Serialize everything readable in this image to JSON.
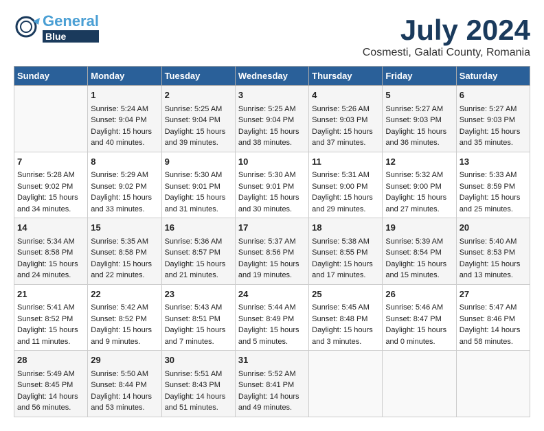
{
  "header": {
    "logo_general": "General",
    "logo_blue": "Blue",
    "month": "July 2024",
    "location": "Cosmesti, Galati County, Romania"
  },
  "weekdays": [
    "Sunday",
    "Monday",
    "Tuesday",
    "Wednesday",
    "Thursday",
    "Friday",
    "Saturday"
  ],
  "weeks": [
    [
      {
        "day": "",
        "content": ""
      },
      {
        "day": "1",
        "content": "Sunrise: 5:24 AM\nSunset: 9:04 PM\nDaylight: 15 hours\nand 40 minutes."
      },
      {
        "day": "2",
        "content": "Sunrise: 5:25 AM\nSunset: 9:04 PM\nDaylight: 15 hours\nand 39 minutes."
      },
      {
        "day": "3",
        "content": "Sunrise: 5:25 AM\nSunset: 9:04 PM\nDaylight: 15 hours\nand 38 minutes."
      },
      {
        "day": "4",
        "content": "Sunrise: 5:26 AM\nSunset: 9:03 PM\nDaylight: 15 hours\nand 37 minutes."
      },
      {
        "day": "5",
        "content": "Sunrise: 5:27 AM\nSunset: 9:03 PM\nDaylight: 15 hours\nand 36 minutes."
      },
      {
        "day": "6",
        "content": "Sunrise: 5:27 AM\nSunset: 9:03 PM\nDaylight: 15 hours\nand 35 minutes."
      }
    ],
    [
      {
        "day": "7",
        "content": "Sunrise: 5:28 AM\nSunset: 9:02 PM\nDaylight: 15 hours\nand 34 minutes."
      },
      {
        "day": "8",
        "content": "Sunrise: 5:29 AM\nSunset: 9:02 PM\nDaylight: 15 hours\nand 33 minutes."
      },
      {
        "day": "9",
        "content": "Sunrise: 5:30 AM\nSunset: 9:01 PM\nDaylight: 15 hours\nand 31 minutes."
      },
      {
        "day": "10",
        "content": "Sunrise: 5:30 AM\nSunset: 9:01 PM\nDaylight: 15 hours\nand 30 minutes."
      },
      {
        "day": "11",
        "content": "Sunrise: 5:31 AM\nSunset: 9:00 PM\nDaylight: 15 hours\nand 29 minutes."
      },
      {
        "day": "12",
        "content": "Sunrise: 5:32 AM\nSunset: 9:00 PM\nDaylight: 15 hours\nand 27 minutes."
      },
      {
        "day": "13",
        "content": "Sunrise: 5:33 AM\nSunset: 8:59 PM\nDaylight: 15 hours\nand 25 minutes."
      }
    ],
    [
      {
        "day": "14",
        "content": "Sunrise: 5:34 AM\nSunset: 8:58 PM\nDaylight: 15 hours\nand 24 minutes."
      },
      {
        "day": "15",
        "content": "Sunrise: 5:35 AM\nSunset: 8:58 PM\nDaylight: 15 hours\nand 22 minutes."
      },
      {
        "day": "16",
        "content": "Sunrise: 5:36 AM\nSunset: 8:57 PM\nDaylight: 15 hours\nand 21 minutes."
      },
      {
        "day": "17",
        "content": "Sunrise: 5:37 AM\nSunset: 8:56 PM\nDaylight: 15 hours\nand 19 minutes."
      },
      {
        "day": "18",
        "content": "Sunrise: 5:38 AM\nSunset: 8:55 PM\nDaylight: 15 hours\nand 17 minutes."
      },
      {
        "day": "19",
        "content": "Sunrise: 5:39 AM\nSunset: 8:54 PM\nDaylight: 15 hours\nand 15 minutes."
      },
      {
        "day": "20",
        "content": "Sunrise: 5:40 AM\nSunset: 8:53 PM\nDaylight: 15 hours\nand 13 minutes."
      }
    ],
    [
      {
        "day": "21",
        "content": "Sunrise: 5:41 AM\nSunset: 8:52 PM\nDaylight: 15 hours\nand 11 minutes."
      },
      {
        "day": "22",
        "content": "Sunrise: 5:42 AM\nSunset: 8:52 PM\nDaylight: 15 hours\nand 9 minutes."
      },
      {
        "day": "23",
        "content": "Sunrise: 5:43 AM\nSunset: 8:51 PM\nDaylight: 15 hours\nand 7 minutes."
      },
      {
        "day": "24",
        "content": "Sunrise: 5:44 AM\nSunset: 8:49 PM\nDaylight: 15 hours\nand 5 minutes."
      },
      {
        "day": "25",
        "content": "Sunrise: 5:45 AM\nSunset: 8:48 PM\nDaylight: 15 hours\nand 3 minutes."
      },
      {
        "day": "26",
        "content": "Sunrise: 5:46 AM\nSunset: 8:47 PM\nDaylight: 15 hours\nand 0 minutes."
      },
      {
        "day": "27",
        "content": "Sunrise: 5:47 AM\nSunset: 8:46 PM\nDaylight: 14 hours\nand 58 minutes."
      }
    ],
    [
      {
        "day": "28",
        "content": "Sunrise: 5:49 AM\nSunset: 8:45 PM\nDaylight: 14 hours\nand 56 minutes."
      },
      {
        "day": "29",
        "content": "Sunrise: 5:50 AM\nSunset: 8:44 PM\nDaylight: 14 hours\nand 53 minutes."
      },
      {
        "day": "30",
        "content": "Sunrise: 5:51 AM\nSunset: 8:43 PM\nDaylight: 14 hours\nand 51 minutes."
      },
      {
        "day": "31",
        "content": "Sunrise: 5:52 AM\nSunset: 8:41 PM\nDaylight: 14 hours\nand 49 minutes."
      },
      {
        "day": "",
        "content": ""
      },
      {
        "day": "",
        "content": ""
      },
      {
        "day": "",
        "content": ""
      }
    ]
  ]
}
